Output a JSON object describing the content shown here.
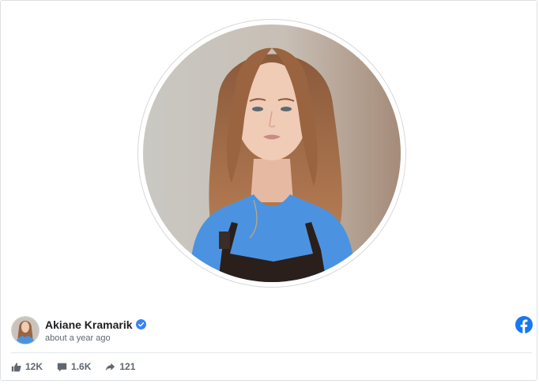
{
  "post": {
    "author_name": "Akiane Kramarik",
    "timestamp": "about a year ago",
    "verified": true
  },
  "stats": {
    "likes": "12K",
    "comments": "1.6K",
    "shares": "121"
  },
  "icons": {
    "like": "thumbs-up-icon",
    "comment": "comment-icon",
    "share": "share-arrow-icon",
    "network": "facebook-logo-icon",
    "verified": "verified-badge-icon"
  },
  "colors": {
    "facebook_blue": "#1877f2",
    "verified_blue": "#3b82f6",
    "muted_text": "#606770"
  }
}
